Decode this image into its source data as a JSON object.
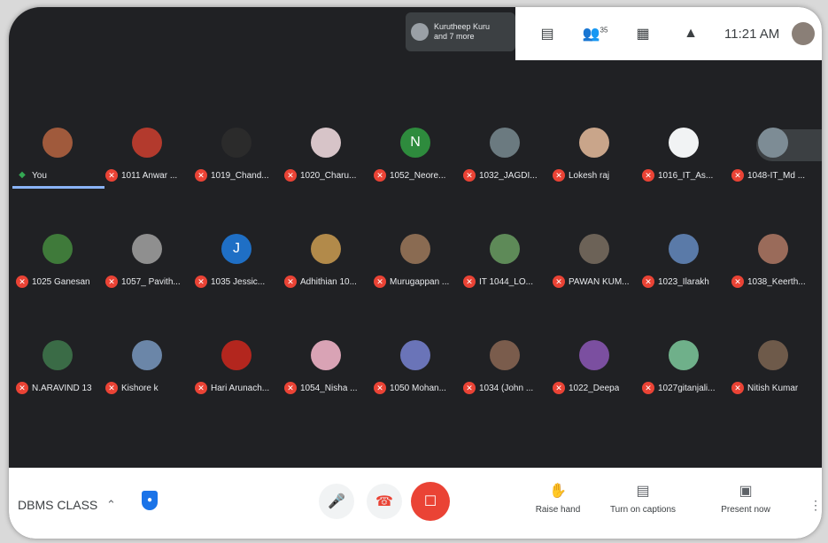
{
  "topbar": {
    "presenter_line1": "Kurutheep Kuru",
    "presenter_line2": "and 7 more",
    "time": "11:21 AM",
    "tools": [
      "meeting-details-icon",
      "people-icon",
      "chat-icon",
      "activities-icon"
    ],
    "people_count": "35"
  },
  "rows": [
    [
      {
        "name": "You",
        "muted": false,
        "avatar_color": "#a05a3c",
        "initial": ""
      },
      {
        "name": "1011 Anwar ...",
        "muted": true,
        "avatar_color": "#b33a2d",
        "initial": ""
      },
      {
        "name": "1019_Chand...",
        "muted": true,
        "avatar_color": "#2b2b2b",
        "initial": ""
      },
      {
        "name": "1020_Charu...",
        "muted": true,
        "avatar_color": "#d7c4c8",
        "initial": ""
      },
      {
        "name": "1052_Neore...",
        "muted": true,
        "avatar_color": "#2e8b3d",
        "initial": "N"
      },
      {
        "name": "1032_JAGDI...",
        "muted": true,
        "avatar_color": "#6b7a80",
        "initial": ""
      },
      {
        "name": "Lokesh raj",
        "muted": true,
        "avatar_color": "#c9a58a",
        "initial": ""
      },
      {
        "name": "1016_IT_As...",
        "muted": true,
        "avatar_color": "#f1f3f4",
        "initial": ""
      },
      {
        "name": "1048-IT_Md ...",
        "muted": true,
        "avatar_color": "#7d8c95",
        "initial": ""
      }
    ],
    [
      {
        "name": "1025 Ganesan",
        "muted": true,
        "avatar_color": "#3f7a3a",
        "initial": ""
      },
      {
        "name": "1057_ Pavith...",
        "muted": true,
        "avatar_color": "#8f8f8f",
        "initial": ""
      },
      {
        "name": "1035 Jessic...",
        "muted": true,
        "avatar_color": "#1f6fc5",
        "initial": "J"
      },
      {
        "name": "Adhithian 10...",
        "muted": true,
        "avatar_color": "#b28a4a",
        "initial": ""
      },
      {
        "name": "Murugappan ...",
        "muted": true,
        "avatar_color": "#8a6b52",
        "initial": ""
      },
      {
        "name": "IT 1044_LO...",
        "muted": true,
        "avatar_color": "#5e8a58",
        "initial": ""
      },
      {
        "name": "PAWAN KUM...",
        "muted": true,
        "avatar_color": "#6c6257",
        "initial": ""
      },
      {
        "name": "1023_Ilarakh",
        "muted": true,
        "avatar_color": "#5a7aa8",
        "initial": ""
      },
      {
        "name": "1038_Keerth...",
        "muted": true,
        "avatar_color": "#9a6b5a",
        "initial": ""
      }
    ],
    [
      {
        "name": "N.ARAVIND 13",
        "muted": true,
        "avatar_color": "#3a6b46",
        "initial": ""
      },
      {
        "name": "Kishore k",
        "muted": true,
        "avatar_color": "#6b86a8",
        "initial": ""
      },
      {
        "name": "Hari Arunach...",
        "muted": true,
        "avatar_color": "#b3261e",
        "initial": ""
      },
      {
        "name": "1054_Nisha ...",
        "muted": true,
        "avatar_color": "#d9a3b5",
        "initial": ""
      },
      {
        "name": "1050 Mohan...",
        "muted": true,
        "avatar_color": "#6a74b8",
        "initial": ""
      },
      {
        "name": "1034 (John ...",
        "muted": true,
        "avatar_color": "#7a5c4c",
        "initial": ""
      },
      {
        "name": "1022_Deepa",
        "muted": true,
        "avatar_color": "#7b4fa0",
        "initial": ""
      },
      {
        "name": "1027gitanjali...",
        "muted": true,
        "avatar_color": "#6fb08a",
        "initial": ""
      },
      {
        "name": "Nitish Kumar",
        "muted": true,
        "avatar_color": "#6e5a4a",
        "initial": ""
      }
    ]
  ],
  "bottombar": {
    "meeting_name": "DBMS CLASS",
    "actions": [
      "Raise hand",
      "Turn on captions",
      "Present now"
    ]
  },
  "colors": {
    "accent": "#8ab4f8",
    "danger": "#ea4335",
    "bg": "#202124"
  }
}
